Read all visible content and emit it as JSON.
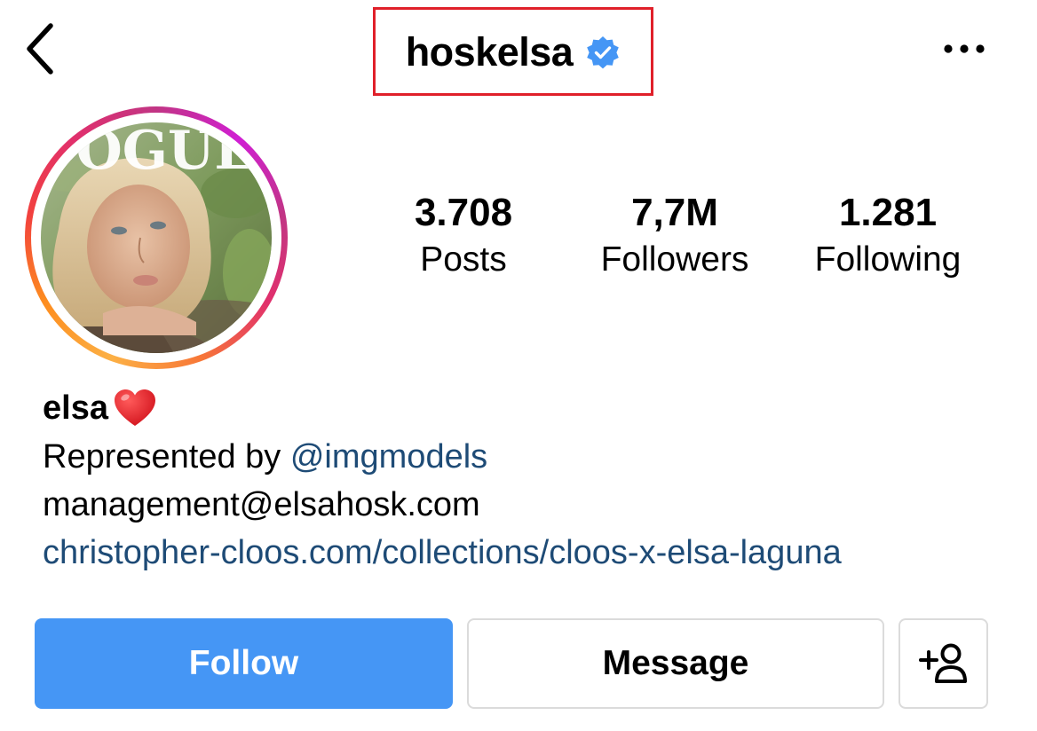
{
  "header": {
    "back_icon": "chevron-left-icon",
    "username": "hoskelsa",
    "verified_icon": "verified-badge-icon",
    "verified_color": "#4596f5",
    "more_icon": "more-horizontal-icon"
  },
  "avatar": {
    "description_icon": "profile-avatar",
    "ring_colors": [
      "#fcb045",
      "#fd1d1d",
      "#c13584",
      "#d01fd3"
    ]
  },
  "stats": {
    "posts": {
      "value": "3.708",
      "label": "Posts"
    },
    "followers": {
      "value": "7,7M",
      "label": "Followers"
    },
    "following": {
      "value": "1.281",
      "label": "Following"
    }
  },
  "bio": {
    "display_name": "elsa",
    "display_name_emoji": "red-heart-icon",
    "line1_prefix": "Represented by ",
    "line1_mention": "@imgmodels",
    "line2": "management@elsahosk.com",
    "line3_link": "christopher-cloos.com/collections/cloos-x-elsa-laguna",
    "link_color": "#1e4b76"
  },
  "actions": {
    "follow_label": "Follow",
    "message_label": "Message",
    "suggest_icon": "add-person-icon",
    "follow_color": "#4596f5"
  }
}
